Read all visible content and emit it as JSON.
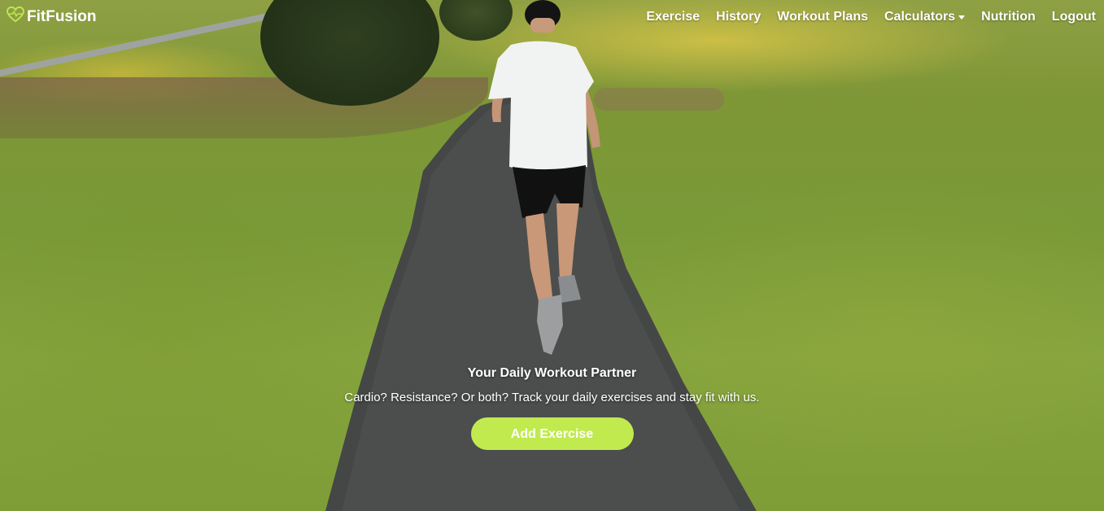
{
  "brand": {
    "name": "FitFusion",
    "icon": "heart-pulse-icon",
    "accent": "#c1ea4f"
  },
  "nav": {
    "items": [
      {
        "label": "Exercise"
      },
      {
        "label": "History"
      },
      {
        "label": "Workout Plans"
      },
      {
        "label": "Calculators",
        "dropdown": true
      },
      {
        "label": "Nutrition"
      },
      {
        "label": "Logout"
      }
    ]
  },
  "hero": {
    "title": "Your Daily Workout Partner",
    "subtitle": "Cardio? Resistance? Or both? Track your daily exercises and stay fit with us.",
    "cta_label": "Add Exercise",
    "background_image": "runner on park path"
  }
}
